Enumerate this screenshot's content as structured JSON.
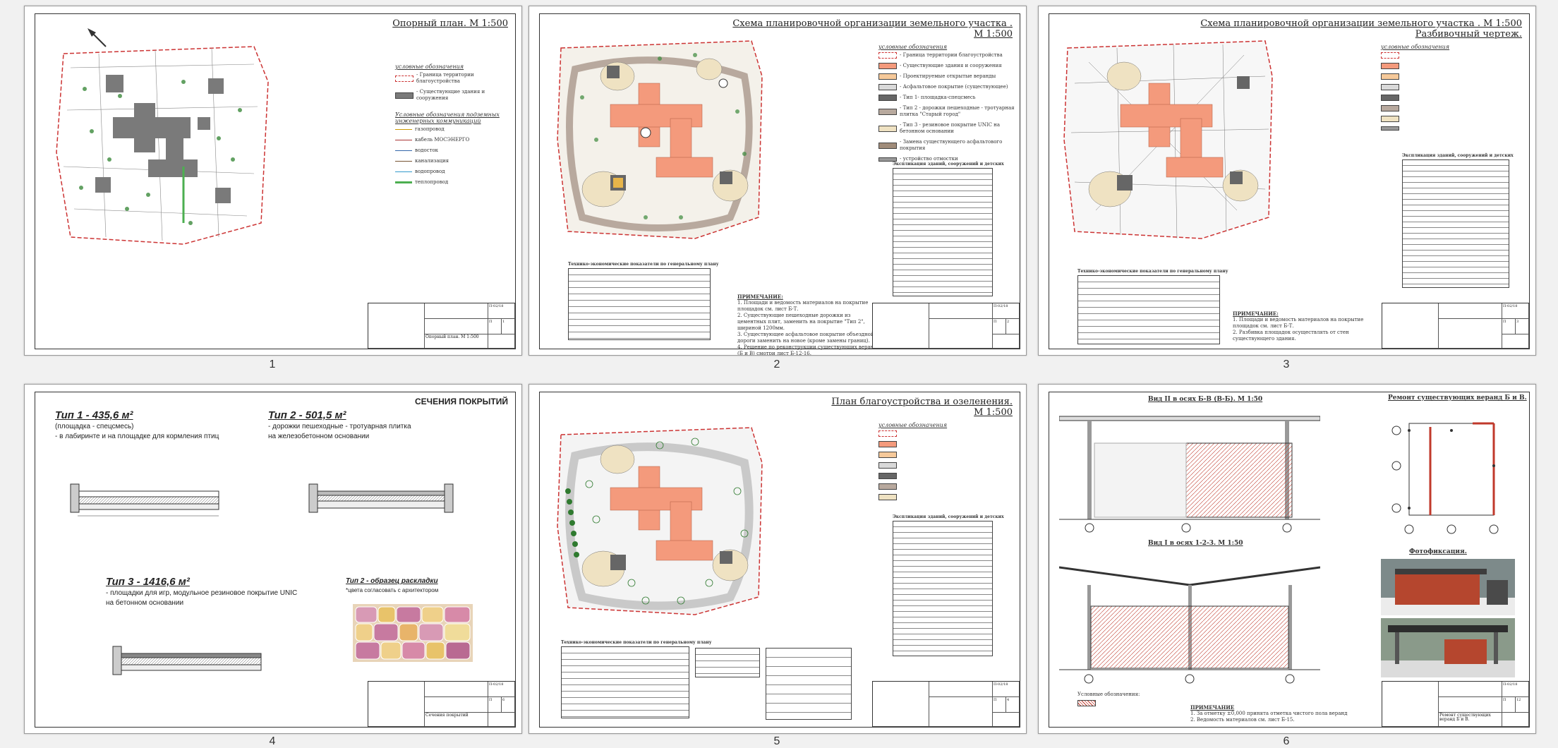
{
  "sheets": [
    {
      "id": 1,
      "page_number": "1",
      "title": "Опорный план. М 1:500",
      "legend": {
        "heading1": "условные обозначения",
        "items1": [
          "- Граница территории благоустройства",
          "- Существующие здания и сооружения"
        ],
        "heading2": "Условные обозначения подземных инженерных коммуникаций",
        "items2": [
          "газопровод",
          "кабель МОСЭНЕРГО",
          "водосток",
          "канализация",
          "водопровод",
          "теплопровод"
        ]
      },
      "stamp": {
        "sheet_name": "Опорный план. М 1:500",
        "code": "П-02/18",
        "stage": "П",
        "sheet": "1"
      }
    },
    {
      "id": 2,
      "page_number": "2",
      "title_line1": "Схема планировочной организации земельного участка .",
      "title_line2": "М 1:500",
      "legend_heading": "условные обозначения",
      "legend": [
        "- Граница территории благоустройства",
        "- Существующие здания и сооружения",
        "- Проектируемые открытые веранды",
        "- Асфальтовое покрытие (существующее)",
        "- Тип 1- площадка-спецсмесь",
        "- Тип 2 - дорожки пешеходные - тротуарная плитка \"Старый город\"",
        "- Тип 3 - резиновое покрытие UNIC на бетонном основании",
        "- Замена существующего асфальтового покрытия",
        "- устройство отмостки"
      ],
      "table_title": "Экспликация зданий, сооружений и детских площадок",
      "tep_title": "Технико-экономические показатели по генеральному плану",
      "note_title": "ПРИМЕЧАНИЕ:",
      "notes": [
        "1. Площади и ведомость материалов на покрытие площадок см. лист Б-Т.",
        "2. Существующие пешеходные дорожки из цементных плит, заменить на покрытие \"Тип 2\", шириной 1200мм.",
        "3. Существующее асфальтовое покрытие объездной дороги заменить на новое (кроме замены границ).",
        "4. Решение по реконструкции существующих веранд (Б и В) смотри лист Б-12-16."
      ],
      "stamp": {
        "code": "П-02/18",
        "stage": "П",
        "sheet": "2"
      }
    },
    {
      "id": 3,
      "page_number": "3",
      "title_line1": "Схема планировочной организации земельного участка . М 1:500",
      "title_line2": "Разбивочный чертеж.",
      "legend_heading": "условные обозначения",
      "table_title": "Экспликация зданий, сооружений и детских площадок",
      "tep_title": "Технико-экономические показатели по генеральному плану",
      "note_title": "ПРИМЕЧАНИЕ:",
      "notes": [
        "1. Площади и ведомость материалов на покрытие площадок см. лист Б-Т.",
        "2. Разбивка площадок осуществлять от стен существующего здания."
      ],
      "stamp": {
        "code": "П-02/18",
        "stage": "П",
        "sheet": "3"
      }
    },
    {
      "id": 4,
      "page_number": "4",
      "title": "СЕЧЕНИЯ ПОКРЫТИЙ",
      "types": [
        {
          "heading": "Тип 1 - 435,6 м²",
          "lines": [
            "(площадка - спецсмесь)",
            "- в лабиринте и на площадке для кормления птиц"
          ]
        },
        {
          "heading": "Тип 2 - 501,5 м²",
          "lines": [
            "- дорожки пешеходные - тротуарная плитка",
            "на железобетонном основании"
          ]
        },
        {
          "heading": "Тип 3 - 1416,6 м²",
          "lines": [
            "- площадки для игр, модульное резиновое покрытие UNIC",
            "на бетонном основании"
          ]
        },
        {
          "heading": "Тип 2 - образец раскладки",
          "lines": [
            "*цвета согласовать с архитектором"
          ]
        }
      ],
      "stamp": {
        "sheet_name": "Сечения покрытий",
        "code": "П-02/18",
        "stage": "П",
        "sheet": "6"
      }
    },
    {
      "id": 5,
      "page_number": "5",
      "title_line1": "План благоустройства и озеленения.",
      "title_line2": "М 1:500",
      "legend_heading": "условные обозначения",
      "table_title": "Экспликация зданий, сооружений и детских площадок",
      "tep_title": "Технико-экономические показатели по генеральному плану",
      "stamp": {
        "code": "П-02/18",
        "stage": "П",
        "sheet": "4"
      }
    },
    {
      "id": 6,
      "page_number": "6",
      "view1": "Вид II в осях Б-В (В-Б). М 1:50",
      "view2": "Вид I в осях 1-2-3. М 1:50",
      "side_title": "Ремонт существующих веранд Б и В.",
      "photo_title": "Фотофиксация.",
      "legend_heading": "Условные обозначения:",
      "note_title": "ПРИМЕЧАНИЕ",
      "notes": [
        "1. За отметку ±0,000 принята отметка чистого пола веранд",
        "2. Ведомость материалов см. лист Б-15."
      ],
      "stamp": {
        "sheet_name": "Ремонт существующих веранд Б и В.",
        "code": "П-02/18",
        "stage": "П",
        "sheet": "12"
      }
    }
  ],
  "colors": {
    "building": "#f49a7c",
    "paving": "#b8a99e",
    "sand": "#efe2c2",
    "asphalt": "#d9d9d9",
    "green": "#2f7a2f"
  }
}
